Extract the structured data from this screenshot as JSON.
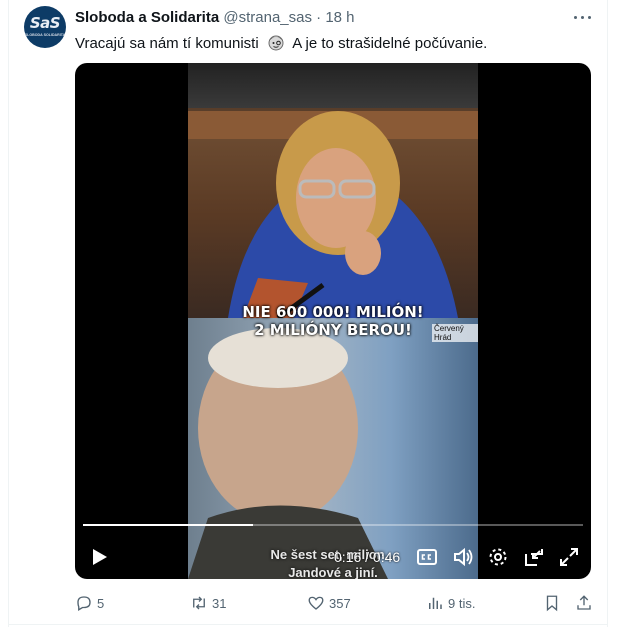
{
  "tweet": {
    "author": {
      "name": "Sloboda a Solidarita",
      "handle": "@strana_sas",
      "separator": "·",
      "time": "18 h",
      "avatar_logo": "SaS",
      "avatar_sub": "SLOBODA SOLIDARITA"
    },
    "text": {
      "before_emoji": "Vracajú sa nám tí komunisti",
      "emoji_icon": "face-with-monocle-icon",
      "after_emoji": "A je to strašidelné počúvanie."
    },
    "video": {
      "caption_top_line1": "NIE 600 000! MILIÓN!",
      "caption_top_line2": "2 MILIÓNY BEROU!",
      "lower_third": "Červený Hrád",
      "caption_bottom_line1": "Ne šest set, milion...",
      "caption_bottom_line2": "Jandové a jiní.",
      "time_display": "0:16 / 0:46",
      "progress_fraction": 0.34
    },
    "actions": {
      "replies": "5",
      "retweets": "31",
      "likes": "357",
      "views": "9 tis."
    },
    "colors": {
      "text": "#0f1419",
      "secondary": "#536471",
      "avatar_bg": "#0d3b66"
    }
  }
}
